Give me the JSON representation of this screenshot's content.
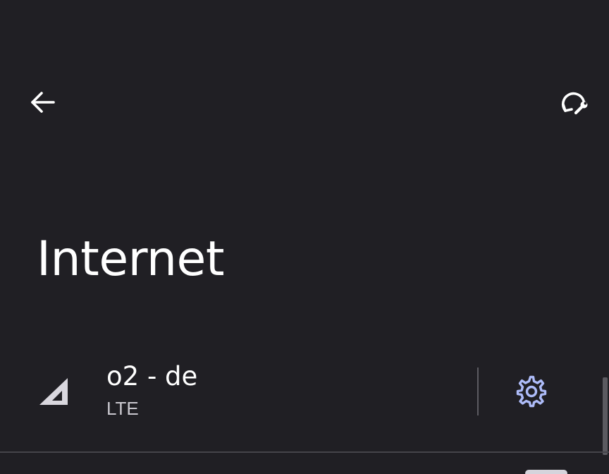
{
  "header": {
    "back_icon": "arrow-back-icon",
    "reset_icon": "network-reset-icon"
  },
  "page": {
    "title": "Internet"
  },
  "network": {
    "name": "o2 - de",
    "type": "LTE",
    "signal_icon": "cellular-signal-icon",
    "settings_icon": "gear-icon",
    "signal_level": 0.5
  },
  "colors": {
    "background": "#201f24",
    "text_primary": "#ffffff",
    "text_secondary": "#c9c7ce",
    "accent": "#aebcf9"
  }
}
